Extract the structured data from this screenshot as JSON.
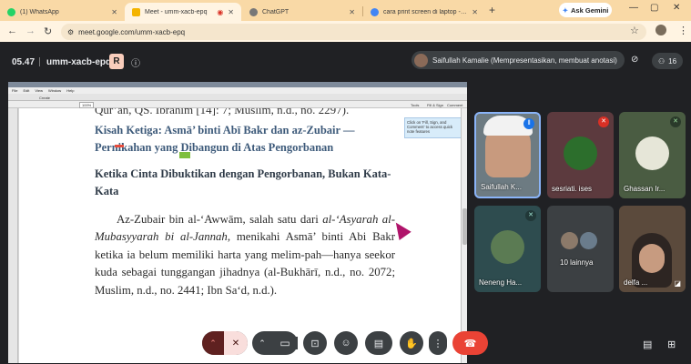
{
  "browser": {
    "tabs": [
      {
        "title": "(1) WhatsApp",
        "color": "#25d366"
      },
      {
        "title": "Meet - umm-xacb-epq",
        "color": "#f4b400"
      },
      {
        "title": "ChatGPT",
        "color": "#888888"
      },
      {
        "title": "cara print screen di laptop - Pe",
        "color": "#4285f4"
      }
    ],
    "ask_gemini": "Ask Gemini",
    "url": "meet.google.com/umm-xacb-epq"
  },
  "meeting": {
    "time": "05.47",
    "code": "umm-xacb-epq",
    "presenter_icon_letter": "R",
    "presenter_label": "Saifullah Kamalie (Mempresentasikan, membuat anotasi)",
    "participant_count": "16"
  },
  "reader": {
    "menu": [
      "File",
      "Edit",
      "View",
      "Window",
      "Help"
    ],
    "toolbar_left": "Create",
    "zoom": "100%",
    "toolbar_right": [
      "Tools",
      "Fill & Sign",
      "Comment"
    ],
    "note_text": "Click on 'Fill, Sign, and Comment' to access quick note features"
  },
  "book": {
    "partial_line": "Qur’an, QS. Ibrahim [14]: 7; Muslim, n.d., no. 2297).",
    "heading1": "Kisah Ketiga: Asmā’ binti Abī Bakr dan az-Zubair — Pernikahan yang Dibangun di Atas Pengorbanan",
    "heading2": "Ketika Cinta Dibuktikan dengan Pengorbanan, Bukan Kata-Kata",
    "para_1": "Az-Zubair bin al-‘Awwām, salah satu dari ",
    "para_italic1": "al-‘Asyarah al-Mubasyyarah bi al-Jannah",
    "para_2": ", menikahi Asmā’ binti Abi Bakr ketika ia belum memiliki harta yang melim-pah—hanya seekor kuda sebagai tunggangan jihadnya (al-Bukhārī, n.d., no. 2072; Muslim, n.d., no. 2441; Ibn Sa‘d, n.d.)."
  },
  "participants": [
    {
      "name": "Saifullah K...",
      "bg": "#6d7b82"
    },
    {
      "name": "sesriati. ises",
      "bg": "#5c3a3e"
    },
    {
      "name": "Ghassan Ir...",
      "bg": "#4a5c42"
    },
    {
      "name": "Neneng Ha...",
      "bg": "#2e4c4f"
    },
    {
      "name": "10 lainnya",
      "bg": "#3c4043"
    },
    {
      "name": "delfa ...",
      "bg": "#5b4a3c"
    }
  ]
}
